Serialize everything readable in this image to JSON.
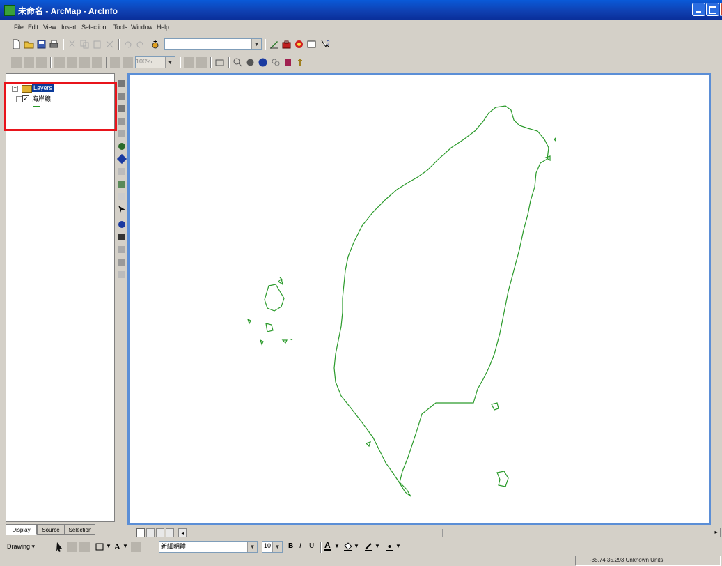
{
  "window": {
    "title": "未命名 - ArcMap - ArcInfo"
  },
  "menu": {
    "items": [
      "File",
      "Edit",
      "View",
      "Insert",
      "Selection",
      "Tools",
      "Window",
      "Help"
    ]
  },
  "toolbar": {
    "scale_value": "",
    "zoom_value": "100%"
  },
  "toc": {
    "root_label": "Layers",
    "layer_label": "海岸線",
    "layer_checked": true,
    "close_glyph": "×"
  },
  "tabs": [
    "Display",
    "Source",
    "Selection"
  ],
  "drawing": {
    "label": "Drawing ▾",
    "font_name": "新細明體",
    "font_size": "10",
    "bold": "B",
    "italic": "I",
    "underline": "U"
  },
  "status": {
    "coordinates": "-35.74  35.293  Unknown Units"
  },
  "colors": {
    "titlebar": "#0f3fb0",
    "map_frame_highlight": "#5b8ed6",
    "toc_highlight": "#e8141b",
    "coastline": "#2a9a2a"
  }
}
